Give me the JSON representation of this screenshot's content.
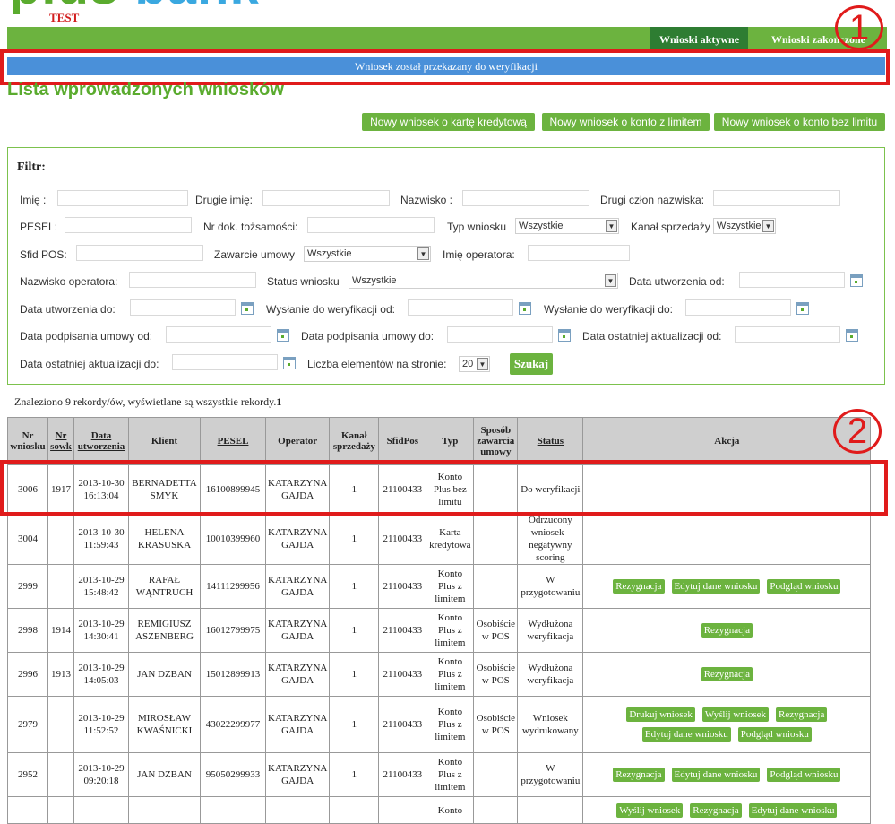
{
  "header": {
    "logo_part1": "p",
    "logo_part2": "l",
    "logo_part3": "u",
    "logo_part4": "s",
    "logo_part5": "",
    "logo_word2": "bank",
    "env_label": "TEST",
    "tabs": [
      {
        "label": "Wnioski aktywne"
      },
      {
        "label": "Wnioski zakończone"
      }
    ]
  },
  "message": "Wniosek został przekazany do weryfikacji",
  "page_title": "Lista wprowadzonych wniosków",
  "annotations": {
    "one": "1",
    "two": "2"
  },
  "actions": {
    "new_card": "Nowy wniosek o kartę kredytową",
    "new_limit": "Nowy wniosek o konto z limitem",
    "new_nolimit": "Nowy wniosek o konto bez limitu"
  },
  "filter": {
    "title": "Filtr:",
    "imie": "Imię :",
    "drugie_imie": "Drugie imię:",
    "nazwisko": "Nazwisko :",
    "drugi_czlon": "Drugi człon nazwiska:",
    "pesel": "PESEL:",
    "nr_dok": "Nr dok. tożsamości:",
    "typ_wniosku": "Typ wniosku",
    "typ_wniosku_value": "Wszystkie",
    "kanal": "Kanał sprzedaży",
    "kanal_value": "Wszystkie",
    "sfid": "Sfid POS:",
    "zawarcie": "Zawarcie umowy",
    "zawarcie_value": "Wszystkie",
    "imie_operatora": "Imię operatora:",
    "nazwisko_operatora": "Nazwisko operatora:",
    "status": "Status wniosku",
    "status_value": "Wszystkie",
    "data_utw_od": "Data utworzenia od:",
    "data_utw_do": "Data utworzenia do:",
    "wysl_od": "Wysłanie do weryfikacji od:",
    "wysl_do": "Wysłanie do weryfikacji do:",
    "podp_od": "Data podpisania umowy od:",
    "podp_do": "Data podpisania umowy do:",
    "akt_od": "Data ostatniej aktualizacji od:",
    "akt_do": "Data ostatniej aktualizacji do:",
    "liczba": "Liczba elementów na stronie:",
    "liczba_value": "20",
    "search": "Szukaj"
  },
  "found_text": "Znaleziono 9 rekordy/ów, wyświetlane są wszystkie rekordy.",
  "found_count": "1",
  "table": {
    "headers": {
      "nr_wniosku": "Nr wniosku",
      "nr_sowk": "Nr sowk",
      "data_utw": "Data utworzenia",
      "klient": "Klient",
      "pesel": "PESEL",
      "operator": "Operator",
      "kanal": "Kanał sprzedaży",
      "sfidpos": "SfidPos",
      "typ": "Typ",
      "sposob": "Sposób zawarcia umowy",
      "status": "Status",
      "akcja": "Akcja"
    },
    "rows": [
      {
        "nr": "3006",
        "sowk": "1917",
        "date": "2013-10-30",
        "time": "16:13:04",
        "client1": "BERNADETTA",
        "client2": "SMYK",
        "pesel": "16100899945",
        "op1": "KATARZYNA",
        "op2": "GAJDA",
        "kanal": "1",
        "sfid": "21100433",
        "typ": "Konto Plus bez limitu",
        "sposob": "",
        "status": "Do weryfikacji",
        "actions": []
      },
      {
        "nr": "3004",
        "sowk": "",
        "date": "2013-10-30",
        "time": "11:59:43",
        "client1": "HELENA",
        "client2": "KRASUSKA",
        "pesel": "10010399960",
        "op1": "KATARZYNA",
        "op2": "GAJDA",
        "kanal": "1",
        "sfid": "21100433",
        "typ": "Karta kredytowa",
        "sposob": "",
        "status": "Odrzucony wniosek - negatywny scoring",
        "actions": []
      },
      {
        "nr": "2999",
        "sowk": "",
        "date": "2013-10-29",
        "time": "15:48:42",
        "client1": "RAFAŁ",
        "client2": "WĄNTRUCH",
        "pesel": "14111299956",
        "op1": "KATARZYNA",
        "op2": "GAJDA",
        "kanal": "1",
        "sfid": "21100433",
        "typ": "Konto Plus z limitem",
        "sposob": "",
        "status": "W przygotowaniu",
        "actions": [
          "Rezygnacja",
          "Edytuj dane wniosku",
          "Podgląd wniosku"
        ]
      },
      {
        "nr": "2998",
        "sowk": "1914",
        "date": "2013-10-29",
        "time": "14:30:41",
        "client1": "REMIGIUSZ",
        "client2": "ASZENBERG",
        "pesel": "16012799975",
        "op1": "KATARZYNA",
        "op2": "GAJDA",
        "kanal": "1",
        "sfid": "21100433",
        "typ": "Konto Plus z limitem",
        "sposob": "Osobiście w POS",
        "status": "Wydłużona weryfikacja",
        "actions": [
          "Rezygnacja"
        ]
      },
      {
        "nr": "2996",
        "sowk": "1913",
        "date": "2013-10-29",
        "time": "14:05:03",
        "client1": "JAN DZBAN",
        "client2": "",
        "pesel": "15012899913",
        "op1": "KATARZYNA",
        "op2": "GAJDA",
        "kanal": "1",
        "sfid": "21100433",
        "typ": "Konto Plus z limitem",
        "sposob": "Osobiście w POS",
        "status": "Wydłużona weryfikacja",
        "actions": [
          "Rezygnacja"
        ]
      },
      {
        "nr": "2979",
        "sowk": "",
        "date": "2013-10-29",
        "time": "11:52:52",
        "client1": "MIROSŁAW",
        "client2": "KWAŚNICKI",
        "pesel": "43022299977",
        "op1": "KATARZYNA",
        "op2": "GAJDA",
        "kanal": "1",
        "sfid": "21100433",
        "typ": "Konto Plus z limitem",
        "sposob": "Osobiście w POS",
        "status": "Wniosek wydrukowany",
        "actions": [
          "Drukuj wniosek",
          "Wyślij wniosek",
          "Rezygnacja",
          "Edytuj dane wniosku",
          "Podgląd wniosku"
        ]
      },
      {
        "nr": "2952",
        "sowk": "",
        "date": "2013-10-29",
        "time": "09:20:18",
        "client1": "JAN DZBAN",
        "client2": "",
        "pesel": "95050299933",
        "op1": "KATARZYNA",
        "op2": "GAJDA",
        "kanal": "1",
        "sfid": "21100433",
        "typ": "Konto Plus z limitem",
        "sposob": "",
        "status": "W przygotowaniu",
        "actions": [
          "Rezygnacja",
          "Edytuj dane wniosku",
          "Podgląd wniosku"
        ]
      },
      {
        "nr": "",
        "sowk": "",
        "date": "",
        "time": "",
        "client1": "",
        "client2": "",
        "pesel": "",
        "op1": "",
        "op2": "",
        "kanal": "",
        "sfid": "",
        "typ": "Konto",
        "sposob": "",
        "status": "",
        "actions": [
          "Wyślij wniosek",
          "Rezygnacja",
          "Edytuj dane wniosku"
        ]
      }
    ]
  },
  "colors": {
    "brand_green": "#6cb33f",
    "dark_green": "#2e7d32",
    "message_blue": "#4a90d9",
    "annotation_red": "#e01b1b"
  }
}
